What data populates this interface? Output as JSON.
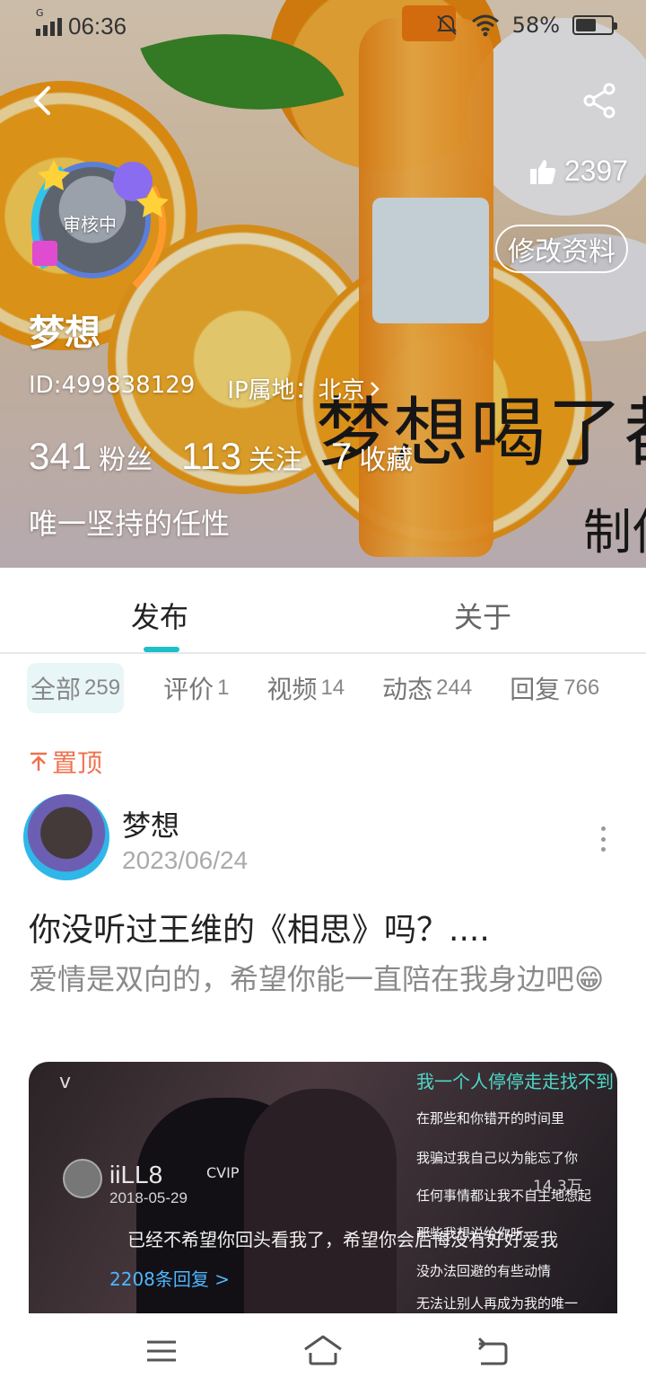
{
  "status_bar": {
    "time": "06:36",
    "network": "G",
    "battery_percent_label": "58%",
    "battery_level": 0.58
  },
  "header": {
    "avatar_overlay": "审核中",
    "likes_count": "2397",
    "edit_button_label": "修改资料",
    "username": "梦想",
    "user_id_label": "ID:499838129",
    "ip_location_label": "IP属地：北京",
    "stats": [
      {
        "value": "341",
        "label": "粉丝"
      },
      {
        "value": "113",
        "label": "关注"
      },
      {
        "value": "7",
        "label": "收藏"
      }
    ],
    "bio": "唯一坚持的任性",
    "banner_text_large": "梦想喝了都",
    "banner_text_small": "制作"
  },
  "tabs": [
    {
      "label": "发布",
      "active": true
    },
    {
      "label": "关于",
      "active": false
    }
  ],
  "filters": [
    {
      "label": "全部",
      "count": "259",
      "active": true
    },
    {
      "label": "评价",
      "count": "1",
      "active": false
    },
    {
      "label": "视频",
      "count": "14",
      "active": false
    },
    {
      "label": "动态",
      "count": "244",
      "active": false
    },
    {
      "label": "回复",
      "count": "766",
      "active": false
    }
  ],
  "post": {
    "pinned_label": "置顶",
    "author": "梦想",
    "date": "2023/06/24",
    "title": "你没听过王维的《相思》吗？....",
    "body": "爱情是双向的，希望你能一直陪在我身边吧😁",
    "media": {
      "chevron": "v",
      "user": "iiLL8",
      "tag": "CVIP",
      "date": "2018-05-29",
      "quote": "已经不希望你回头看我了，希望你会后悔没有好好爱我",
      "replies": "2208条回复 >",
      "count": "14.3万",
      "lyrics": [
        "我一个人停停走走找不到",
        "在那些和你错开的时间里",
        "我骗过我自己以为能忘了你",
        "任何事情都让我不自主地想起",
        "那些我想说给你听",
        "没办法回避的有些动情",
        "无法让别人再成为我的唯一"
      ]
    }
  },
  "colors": {
    "accent": "#1cc0c8",
    "pinned": "#f0704e",
    "chip_active_bg": "#e8f6f8"
  },
  "icons": [
    "back-icon",
    "share-icon",
    "thumbs-up-icon",
    "chevron-right-icon",
    "pin-arrow-icon",
    "more-vertical-icon",
    "menu-icon",
    "home-icon",
    "back-nav-icon"
  ]
}
